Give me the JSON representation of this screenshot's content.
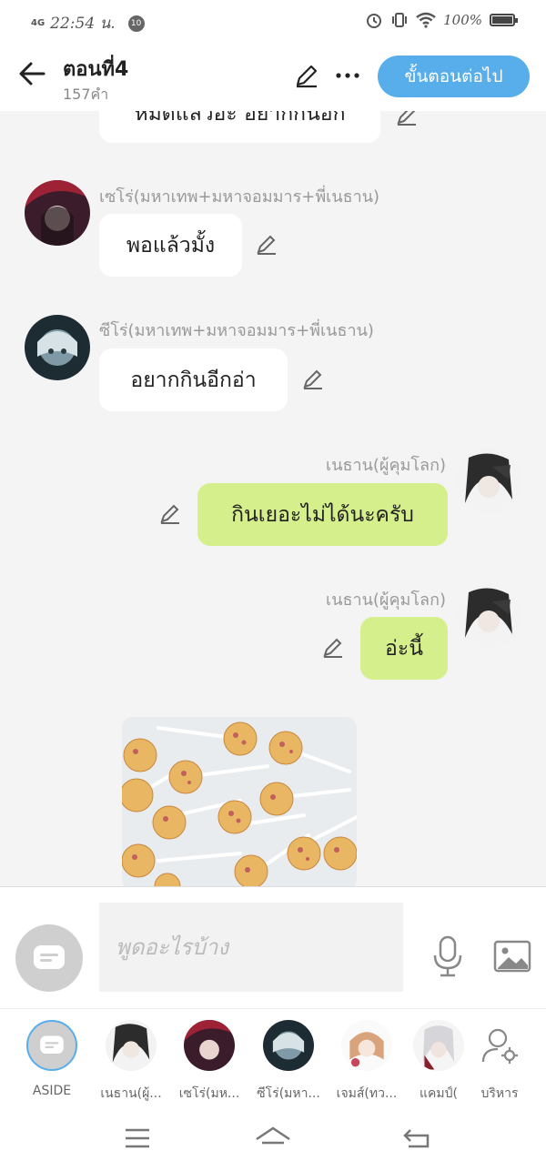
{
  "status": {
    "network": "4G",
    "time": "22:54 น.",
    "badge": "10",
    "battery": "100%"
  },
  "header": {
    "title": "ตอนที่4",
    "word_count": "157คำ",
    "next_label": "ขั้นตอนต่อไป"
  },
  "messages": [
    {
      "side": "left",
      "text": "หมดแล้วอะ อยากกินอีก"
    },
    {
      "side": "left",
      "sender": "เซโร่(มหาเทพ+มหาจอมมาร+พี่เนธาน)",
      "text": "พอแล้วมั้ง"
    },
    {
      "side": "left",
      "sender": "ซีโร่(มหาเทพ+มหาจอมมาร+พี่เนธาน)",
      "text": "อยากกินอีกอ่า"
    },
    {
      "side": "right",
      "sender": "เนธาน(ผู้คุมโลก)",
      "text": "กินเยอะไม่ได้นะครับ"
    },
    {
      "side": "right",
      "sender": "เนธาน(ผู้คุมโลก)",
      "text": "อ่ะนี้"
    }
  ],
  "input": {
    "placeholder": "พูดอะไรบ้าง"
  },
  "characters": [
    {
      "label": "ASIDE"
    },
    {
      "label": "เนธาน(ผู้..."
    },
    {
      "label": "เซโร่(มห..."
    },
    {
      "label": "ซีโร่(มหา..."
    },
    {
      "label": "เจมส์(ทว..."
    },
    {
      "label": "แคมป์("
    },
    {
      "label": "บริหาร"
    }
  ],
  "colors": {
    "accent": "#58aeea",
    "right_bubble": "#d6ef8d",
    "left_bubble": "#ffffff",
    "background": "#f4f4f4"
  }
}
